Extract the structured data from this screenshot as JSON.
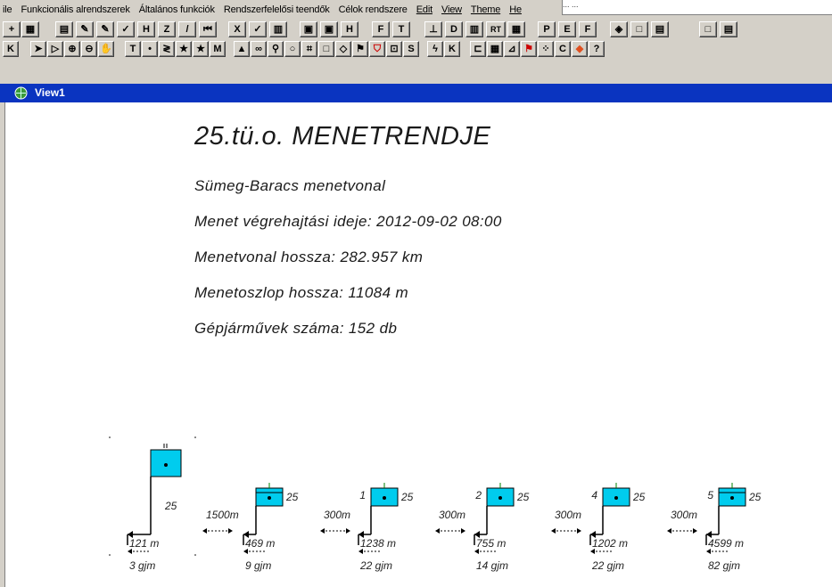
{
  "menu": {
    "items": [
      "ile",
      "Funkcionális alrendszerek",
      "Általános funkciók",
      "Rendszerfelelősi teendők",
      "Célok rendszere",
      "Edit",
      "View",
      "Theme",
      "He"
    ],
    "right_text": "... ..."
  },
  "toolbar1": {
    "labels": [
      "H",
      "Z",
      "/",
      "X",
      "✓",
      "H",
      "F",
      "T",
      "D",
      "RT",
      "P",
      "E",
      "F"
    ]
  },
  "toolbar2": {
    "labels": [
      "K",
      "T",
      "M",
      "S",
      "K",
      "C",
      "?"
    ]
  },
  "window": {
    "title": "View1"
  },
  "doc": {
    "heading": "25.tü.o.   MENETRENDJE",
    "route": "Sümeg-Baracs   menetvonal",
    "exec_time": "Menet végrehajtási ideje:   2012-09-02 08:00",
    "route_length": "Menetvonal hossza:   282.957 km",
    "column_length": "Menetoszlop hossza:   11084 m",
    "vehicles": "Gépjárművek száma:   152 db"
  },
  "units": [
    {
      "label_left": "",
      "number": "25",
      "length": "121 m",
      "vehicles": "3 gjm",
      "gap": "1500m"
    },
    {
      "label_left": "",
      "number": "25",
      "length": "469 m",
      "vehicles": "9 gjm",
      "gap": "300m"
    },
    {
      "label_left": "1",
      "number": "25",
      "length": "1238 m",
      "vehicles": "22 gjm",
      "gap": "300m"
    },
    {
      "label_left": "2",
      "number": "25",
      "length": "755 m",
      "vehicles": "14 gjm",
      "gap": "300m"
    },
    {
      "label_left": "4",
      "number": "25",
      "length": "1202 m",
      "vehicles": "22 gjm",
      "gap": "300m"
    },
    {
      "label_left": "5",
      "number": "25",
      "length": "4599 m",
      "vehicles": "82 gjm",
      "gap": ""
    }
  ],
  "colors": {
    "unit_fill": "#00ccee",
    "titlebar": "#0a34c0"
  }
}
